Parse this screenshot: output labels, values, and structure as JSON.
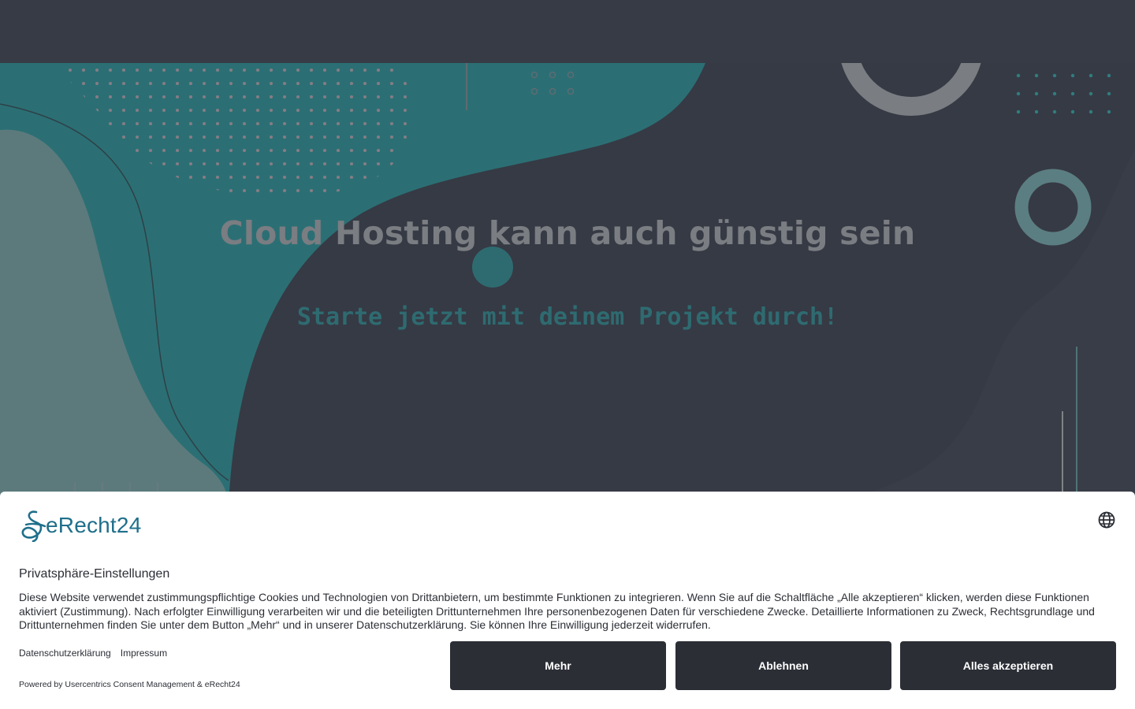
{
  "hero": {
    "title": "Cloud Hosting kann auch günstig sein",
    "subtitle": "Starte jetzt mit deinem Projekt durch!"
  },
  "consent": {
    "logo_text": "eRecht24",
    "language_icon": "globe-icon",
    "title": "Privatsphäre-Einstellungen",
    "body": "Diese Website verwendet zustimmungspflichtige Cookies und Technologien von Drittanbietern, um bestimmte Funktionen zu integrieren. Wenn Sie auf die Schaltfläche „Alle akzeptieren“ klicken, werden diese Funktionen aktiviert (Zustimmung). Nach erfolgter Einwilligung verarbeiten wir und die beteiligten Drittunternehmen Ihre personenbezogenen Daten für verschiedene Zwecke. Detaillierte Informationen zu Zweck, Rechtsgrundlage und Drittunternehmen finden Sie unter dem Button „Mehr“ und in unserer Datenschutzerklärung. Sie können Ihre Einwilligung jederzeit widerrufen.",
    "links": {
      "privacy": "Datenschutzerklärung",
      "imprint": "Impressum"
    },
    "powered_by": "Powered by Usercentrics Consent Management & eRecht24",
    "buttons": {
      "more": "Mehr",
      "deny": "Ablehnen",
      "accept": "Alles akzeptieren"
    }
  },
  "colors": {
    "background": "#363a44",
    "teal": "#2e6b71",
    "button": "#2b2e35",
    "logo": "#1f6f8b"
  }
}
